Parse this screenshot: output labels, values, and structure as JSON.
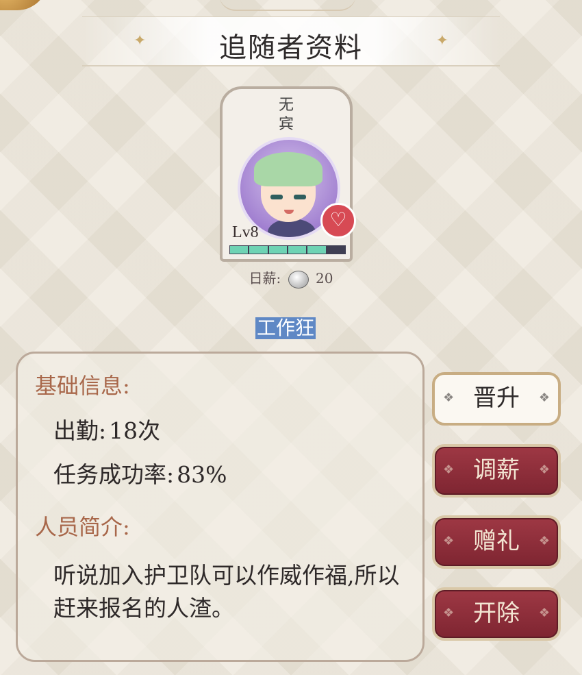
{
  "header": {
    "title": "追随者资料"
  },
  "follower": {
    "name": "无宾",
    "level": "Lv8",
    "exp_fraction": 0.78,
    "salary_label": "日薪:",
    "salary_value": "20",
    "trait": "工作狂"
  },
  "info": {
    "basic_title": "基础信息:",
    "attendance_label": "出勤:",
    "attendance_value": "18次",
    "success_label": "任务成功率:",
    "success_value": "83%",
    "intro_title": "人员简介:",
    "intro_text": "听说加入护卫队可以作威作福,所以赶来报名的人渣。"
  },
  "actions": {
    "promote": "晋升",
    "adjust_salary": "调薪",
    "gift": "赠礼",
    "dismiss": "开除"
  },
  "colors": {
    "accent_red": "#8a2b38",
    "exp_fill": "#6fd3b4",
    "section_title": "#a8674a",
    "trait_highlight": "#5f88c5"
  }
}
